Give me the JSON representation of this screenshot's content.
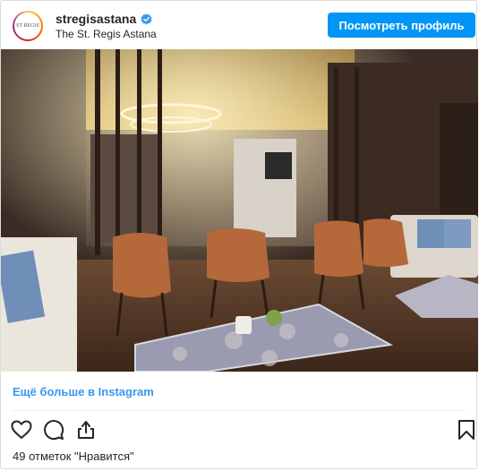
{
  "header": {
    "username": "stregisastana",
    "location": "The St. Regis Astana",
    "avatar_text": "ST REGIS",
    "profile_button_label": "Посмотреть профиль"
  },
  "post": {
    "more_link": "Ещё больше в Instagram",
    "likes_text": "49 отметок \"Нравится\""
  },
  "icons": {
    "verified": "verified-badge-icon",
    "like": "heart-icon",
    "comment": "comment-icon",
    "share": "share-icon",
    "save": "bookmark-icon"
  },
  "colors": {
    "accent": "#0095f6",
    "link": "#3897f0",
    "text": "#262626"
  }
}
